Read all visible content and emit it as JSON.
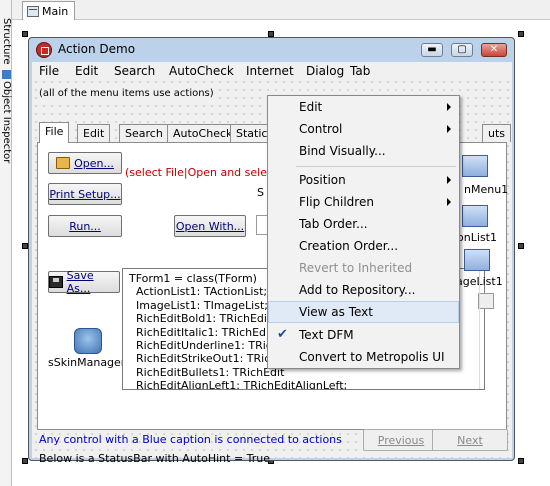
{
  "left_strip": {
    "tab1": "Structure",
    "tab2": "Object Inspector"
  },
  "doc_tab": {
    "label": "Main"
  },
  "form": {
    "title": "Action Demo",
    "titlebar_buttons": {
      "minimize": "▬",
      "maximize": "▢",
      "close": "✕"
    },
    "menu": [
      "File",
      "Edit",
      "Search",
      "AutoCheck",
      "Internet",
      "Dialog",
      "Tab"
    ],
    "hint": "(all of the menu items use actions)",
    "tabs": [
      "File",
      "Edit",
      "Search",
      "AutoCheck",
      "Static"
    ],
    "tab_right": "uts",
    "buttons": {
      "open": "Open...",
      "print_setup": "Print Setup...",
      "run": "Run...",
      "open_with": "Open With...",
      "save_as": "Save As..."
    },
    "red_note": "(select File|Open and select",
    "s_label": "S",
    "code_lines": [
      "TForm1 = class(TForm)",
      "  ActionList1: TActionList;",
      "  ImageList1: TImageList;",
      "  RichEditBold1: TRichEdit",
      "  RichEditItalic1: TRichEdit",
      "  RichEditUnderline1: TRich",
      "  RichEditStrikeOut1: TRich",
      "  RichEditBullets1: TRichEdit",
      "  RichEditAlignLeft1: TRichEditAlignLeft;"
    ],
    "skin_label": "sSkinManager1",
    "right_labels": [
      "nMenu1",
      "ionList1",
      "ageList1"
    ],
    "blue_note": "Any control with a Blue caption is connected to actions",
    "status_note": "Below is a StatusBar with AutoHint = True",
    "nav": {
      "previous": "Previous",
      "next": "Next"
    }
  },
  "context_menu": {
    "items": [
      {
        "label": "Edit",
        "submenu": true
      },
      {
        "label": "Control",
        "submenu": true
      },
      {
        "label": "Bind Visually..."
      },
      {
        "label": "Position",
        "submenu": true
      },
      {
        "label": "Flip Children",
        "submenu": true
      },
      {
        "label": "Tab Order..."
      },
      {
        "label": "Creation Order..."
      },
      {
        "label": "Revert to Inherited",
        "disabled": true
      },
      {
        "label": "Add to Repository..."
      },
      {
        "label": "View as Text",
        "highlighted": true
      },
      {
        "label": "Text DFM",
        "checked": true
      },
      {
        "label": "Convert to Metropolis UI"
      }
    ]
  }
}
